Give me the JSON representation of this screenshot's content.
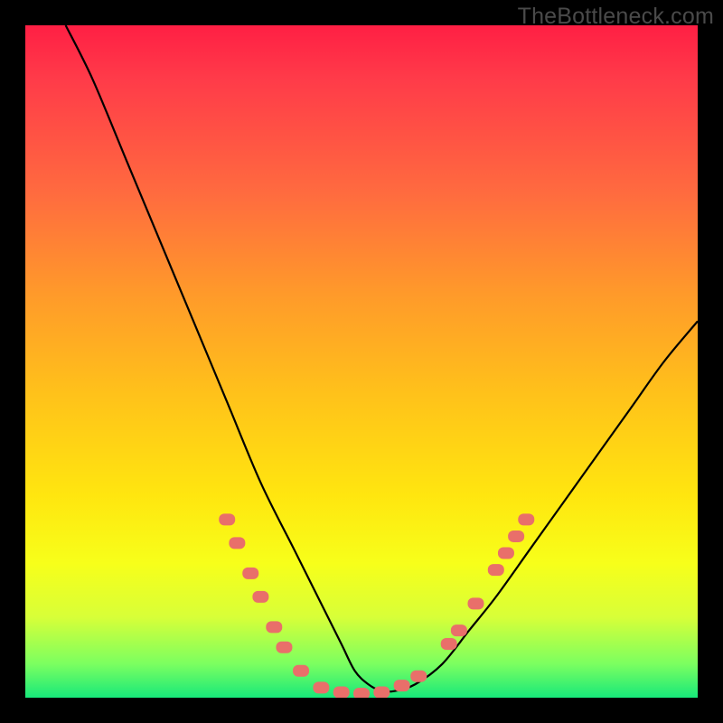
{
  "watermark": "TheBottleneck.com",
  "chart_data": {
    "type": "line",
    "title": "",
    "xlabel": "",
    "ylabel": "",
    "xlim": [
      0,
      100
    ],
    "ylim": [
      0,
      100
    ],
    "grid": false,
    "legend": false,
    "series": [
      {
        "name": "bottleneck-curve",
        "x": [
          6,
          10,
          15,
          20,
          25,
          30,
          35,
          40,
          44,
          47,
          49,
          51,
          53,
          55,
          58,
          62,
          66,
          70,
          75,
          80,
          85,
          90,
          95,
          100
        ],
        "y": [
          100,
          92,
          80,
          68,
          56,
          44,
          32,
          22,
          14,
          8,
          4,
          2,
          1,
          1,
          2,
          5,
          10,
          15,
          22,
          29,
          36,
          43,
          50,
          56
        ]
      }
    ],
    "markers": {
      "name": "highlighted-points",
      "points": [
        {
          "x": 30.0,
          "y": 26.5
        },
        {
          "x": 31.5,
          "y": 23.0
        },
        {
          "x": 33.5,
          "y": 18.5
        },
        {
          "x": 35.0,
          "y": 15.0
        },
        {
          "x": 37.0,
          "y": 10.5
        },
        {
          "x": 38.5,
          "y": 7.5
        },
        {
          "x": 41.0,
          "y": 4.0
        },
        {
          "x": 44.0,
          "y": 1.5
        },
        {
          "x": 47.0,
          "y": 0.8
        },
        {
          "x": 50.0,
          "y": 0.6
        },
        {
          "x": 53.0,
          "y": 0.8
        },
        {
          "x": 56.0,
          "y": 1.8
        },
        {
          "x": 58.5,
          "y": 3.2
        },
        {
          "x": 63.0,
          "y": 8.0
        },
        {
          "x": 64.5,
          "y": 10.0
        },
        {
          "x": 67.0,
          "y": 14.0
        },
        {
          "x": 70.0,
          "y": 19.0
        },
        {
          "x": 71.5,
          "y": 21.5
        },
        {
          "x": 73.0,
          "y": 24.0
        },
        {
          "x": 74.5,
          "y": 26.5
        }
      ]
    }
  }
}
